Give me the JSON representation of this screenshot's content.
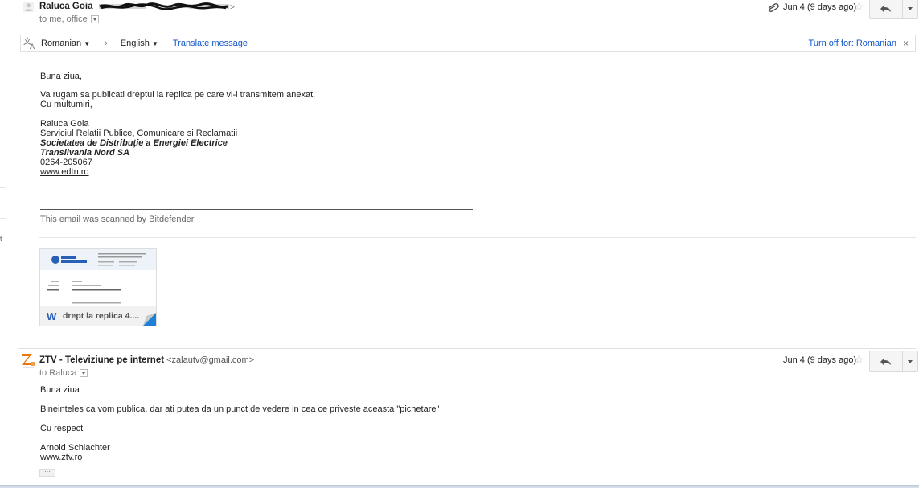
{
  "msg1": {
    "sender": "Raluca Goia",
    "recipients": "to me, office",
    "date": "Jun 4 (9 days ago)"
  },
  "translate": {
    "from_lang": "Romanian",
    "to_lang": "English",
    "translate_link": "Translate message",
    "turn_off": "Turn off for: Romanian"
  },
  "body1": {
    "greeting": "Buna ziua,",
    "line1": "Va rugam sa publicati dreptul la replica pe care vi-l transmitem anexat.",
    "line2": "Cu multumiri,",
    "sig_name": "Raluca Goia",
    "sig_dept": "Serviciul Relatii Publice, Comunicare si Reclamatii",
    "sig_company1": "Societatea de Distribuție a Energiei Electrice",
    "sig_company2": "Transilvania Nord SA",
    "sig_phone": "0264-205067",
    "sig_web": "www.edtn.ro",
    "scanned": "This email was scanned by Bitdefender"
  },
  "attachment": {
    "name": "drept la replica 4....",
    "icon": "W"
  },
  "msg2": {
    "sender": "ZTV - Televiziune pe internet",
    "email": "<zalautv@gmail.com>",
    "recipients": "to Raluca",
    "date": "Jun 4 (9 days ago)"
  },
  "body2": {
    "greeting": "Buna ziua",
    "line1": "Bineinteles ca vom publica, dar ati putea da un punct de vedere in cea ce priveste aceasta \"pichetare\"",
    "closing": "Cu respect",
    "sig_name": "Arnold Schlachter",
    "sig_web": "www.ztv.ro"
  },
  "left_fragment": "t",
  "colors": {
    "link": "#1155cc",
    "word_blue": "#2a5fb8",
    "ztv_orange": "#e8760c"
  }
}
